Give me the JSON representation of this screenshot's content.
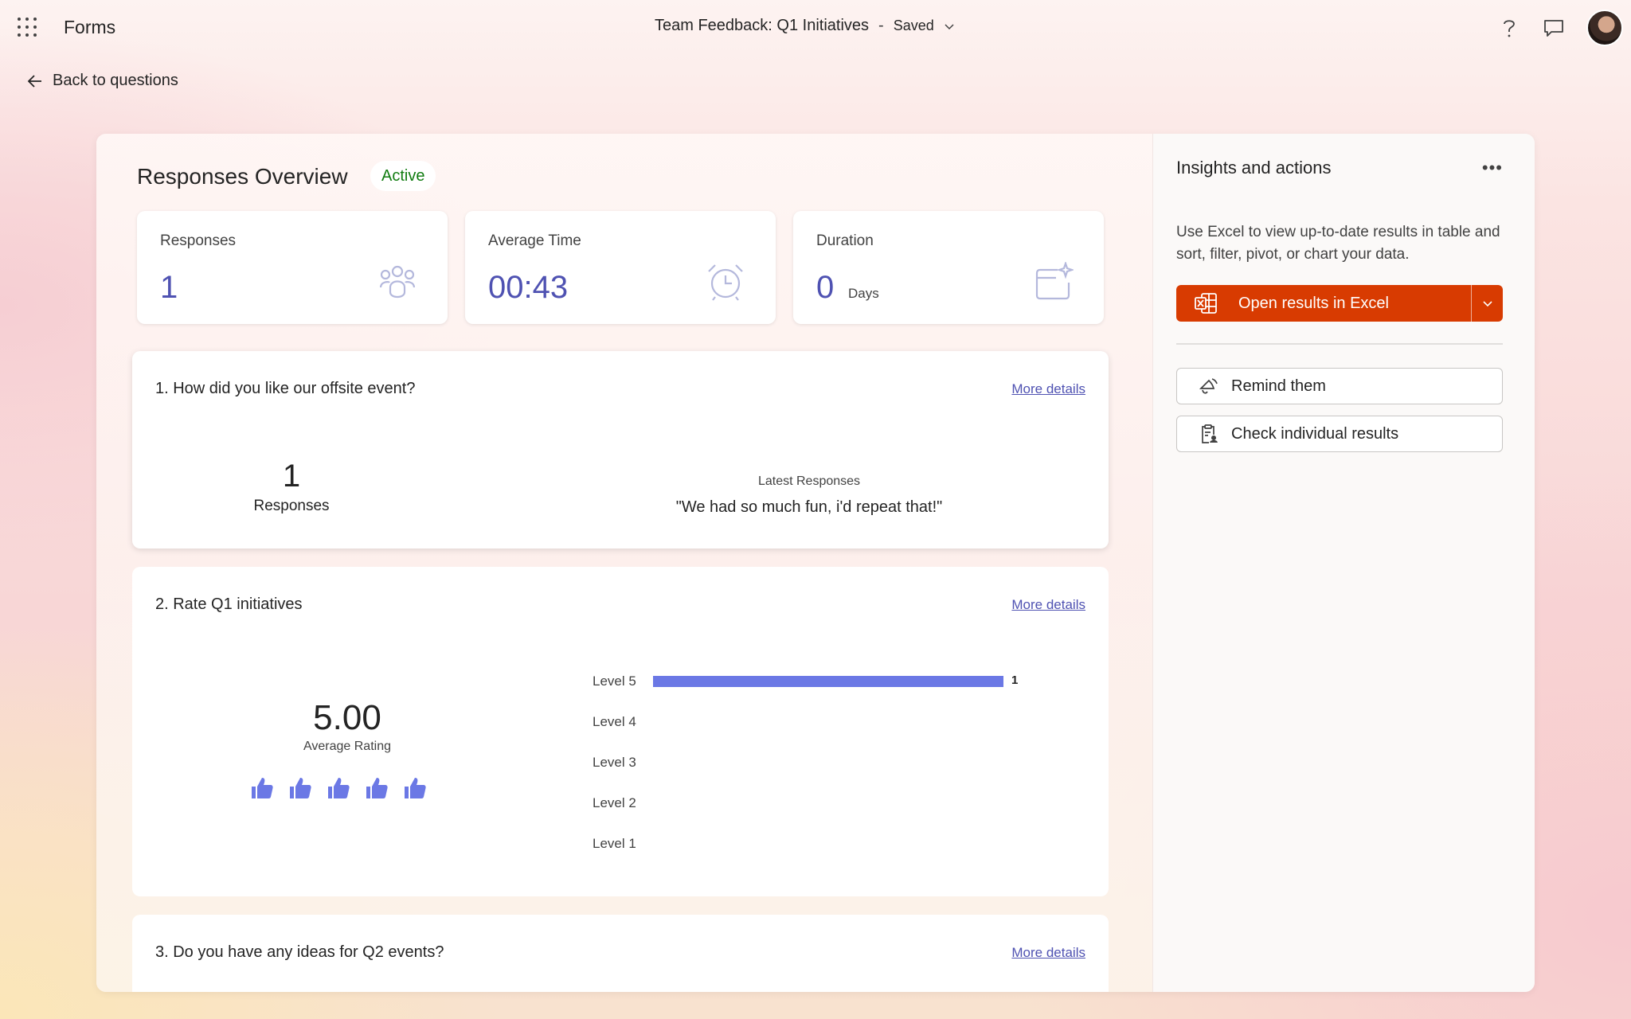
{
  "app": {
    "name": "Forms"
  },
  "document": {
    "title": "Team Feedback: Q1 Initiatives",
    "separator": "-",
    "status": "Saved"
  },
  "topbar": {
    "icons": [
      "app-launcher-icon",
      "help-icon",
      "comment-icon",
      "avatar"
    ]
  },
  "nav": {
    "back_label": "Back to questions"
  },
  "overview": {
    "title": "Responses Overview",
    "status_badge": "Active",
    "stats": [
      {
        "label": "Responses",
        "value": "1",
        "icon": "people-icon"
      },
      {
        "label": "Average Time",
        "value": "00:43",
        "icon": "alarm-clock-icon"
      },
      {
        "label": "Duration",
        "value": "0",
        "unit": "Days",
        "icon": "calendar-sparkle-icon"
      }
    ]
  },
  "questions": [
    {
      "title": "1. How did you like our offsite event?",
      "more_label": "More details",
      "response_count": "1",
      "response_count_label": "Responses",
      "latest_caption": "Latest Responses",
      "latest_text": "\"We had so much fun, i'd repeat that!\""
    },
    {
      "title": "2. Rate Q1 initiatives",
      "more_label": "More details",
      "average": "5.00",
      "average_label": "Average Rating",
      "rating_icons": 5
    },
    {
      "title": "3. Do you have any ideas for Q2 events?",
      "more_label": "More details"
    }
  ],
  "chart_data": {
    "type": "bar",
    "orientation": "horizontal",
    "categories": [
      "Level 5",
      "Level 4",
      "Level 3",
      "Level 2",
      "Level 1"
    ],
    "values": [
      1,
      0,
      0,
      0,
      0
    ],
    "value_labels": [
      "1",
      "",
      "",
      "",
      ""
    ],
    "xlim": [
      0,
      1
    ],
    "color": "#6b78e5"
  },
  "insights": {
    "title": "Insights and actions",
    "more_icon": "more-horizontal-icon",
    "description": "Use Excel to view up-to-date results in table and sort, filter, pivot, or chart your data.",
    "excel_button": "Open results in Excel",
    "remind_button": "Remind them",
    "check_button": "Check individual results"
  },
  "colors": {
    "accent": "#4f52b2",
    "excel": "#d83b01",
    "active": "#107c10",
    "bar": "#6b78e5"
  }
}
